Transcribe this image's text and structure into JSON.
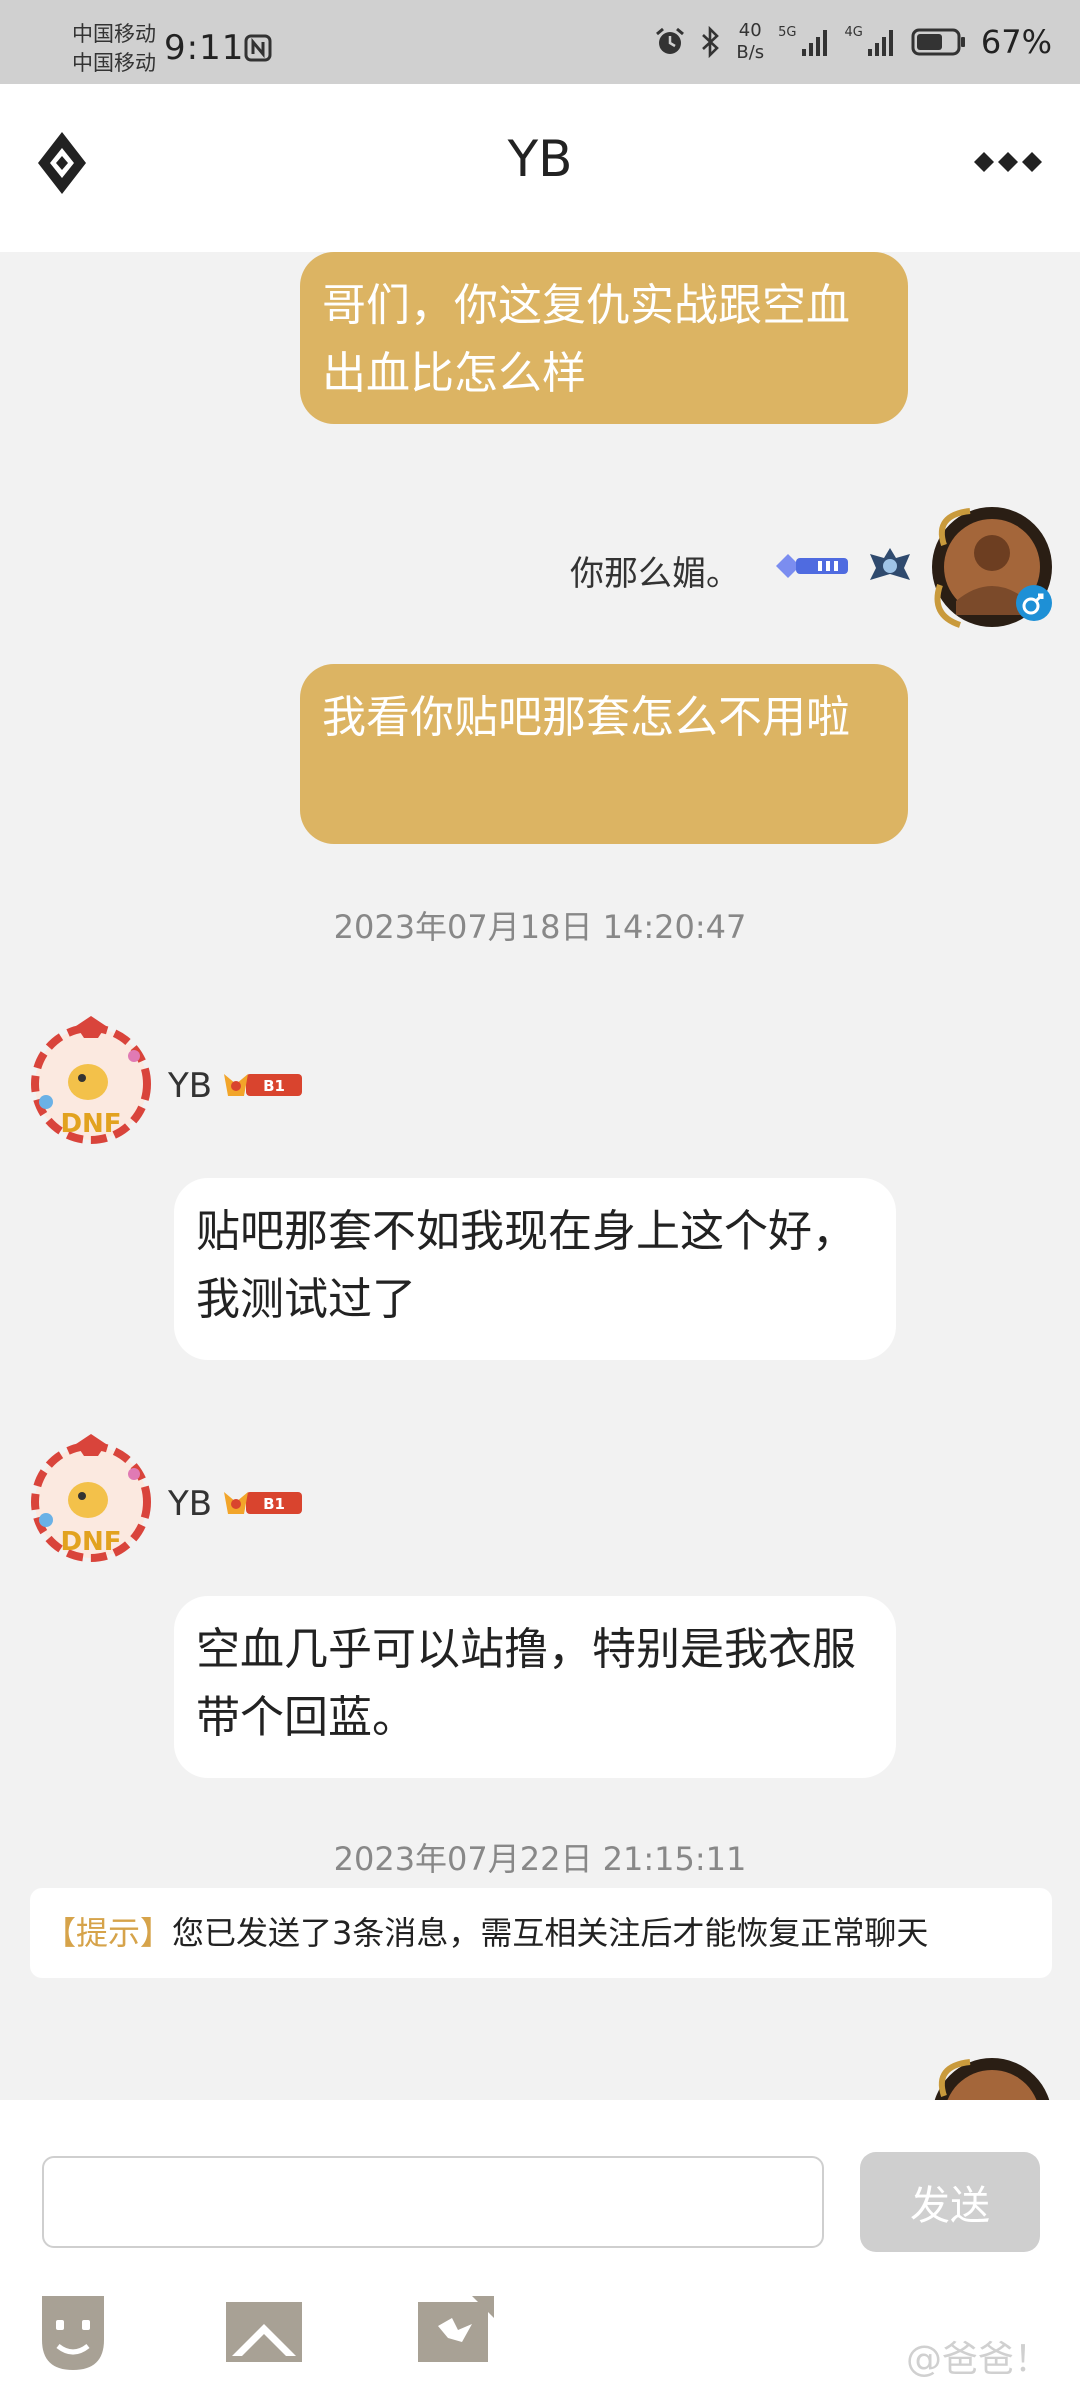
{
  "status_bar": {
    "carrier_1": "中国移动",
    "carrier_2": "中国移动",
    "time": "9:11",
    "net_speed_value": "40",
    "net_speed_unit": "B/s",
    "signal_1_tag": "5G",
    "signal_2_tag": "4G",
    "battery": "67%",
    "battery_level": 0.67
  },
  "header": {
    "title": "YB"
  },
  "messages": [
    {
      "side": "mine",
      "text": "哥们，你这复仇实战跟空血出血比怎么样"
    },
    {
      "side": "mine",
      "caption": "你那么媚。",
      "text": "我看你贴吧那套怎么不用啦"
    },
    {
      "timestamp": "2023年07月18日 14:20:47"
    },
    {
      "side": "theirs",
      "sender": "YB",
      "level": "B1",
      "text": "贴吧那套不如我现在身上这个好，我测试过了"
    },
    {
      "side": "theirs",
      "sender": "YB",
      "level": "B1",
      "text": "空血几乎可以站撸，特别是我衣服带个回蓝。"
    },
    {
      "timestamp": "2023年07月22日 21:15:11"
    }
  ],
  "notice": {
    "tag": "【提示】",
    "text": "您已发送了3条消息，需互相关注后才能恢复正常聊天"
  },
  "composer": {
    "input_value": "",
    "send_label": "发送"
  },
  "icons": [
    "logo-icon",
    "more-icon",
    "emoji-icon",
    "image-icon",
    "puzzle-icon"
  ],
  "watermark": "@爸爸！",
  "colors": {
    "my_bubble": "#dcb463",
    "their_bubble": "#ffffff",
    "notice_tag": "#d6a34a",
    "send_button": "#cfcfcf"
  }
}
